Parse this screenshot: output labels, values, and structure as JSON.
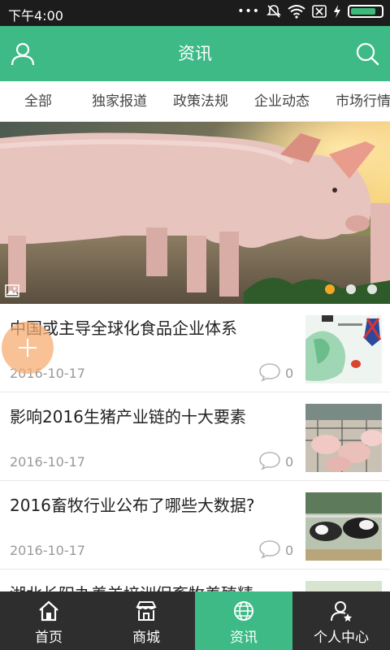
{
  "status_bar": {
    "time": "下午4:00",
    "icons": [
      "more-dots-icon",
      "mute-icon",
      "wifi-icon",
      "sim-icon",
      "charging-icon",
      "battery-icon"
    ]
  },
  "header": {
    "title": "资讯",
    "left_icon": "user-icon",
    "right_icon": "search-icon"
  },
  "tabs": [
    "全部",
    "独家报道",
    "政策法规",
    "企业动态",
    "市场行情"
  ],
  "banner": {
    "slides": 3,
    "active_slide": 1,
    "icon": "image-icon"
  },
  "news": [
    {
      "title": "中国或主导全球化食品企业体系",
      "date": "2016-10-17",
      "comments": "0"
    },
    {
      "title": "影响2016生猪产业链的十大要素",
      "date": "2016-10-17",
      "comments": "0"
    },
    {
      "title": "2016畜牧行业公布了哪些大数据?",
      "date": "2016-10-17",
      "comments": "0"
    },
    {
      "title": "湖北长阳办养羊培训促畜牧养殖精",
      "date": "",
      "comments": ""
    }
  ],
  "bottom_nav": [
    {
      "label": "首页",
      "icon": "home-icon"
    },
    {
      "label": "商城",
      "icon": "store-icon"
    },
    {
      "label": "资讯",
      "icon": "globe-icon"
    },
    {
      "label": "个人中心",
      "icon": "profile-icon"
    }
  ],
  "colors": {
    "primary": "#3dba86",
    "nav_bg": "#2e2e2e",
    "status_bg": "#1c1c1c",
    "fab": "#f6aa6e",
    "dot_active": "#f5a623"
  }
}
